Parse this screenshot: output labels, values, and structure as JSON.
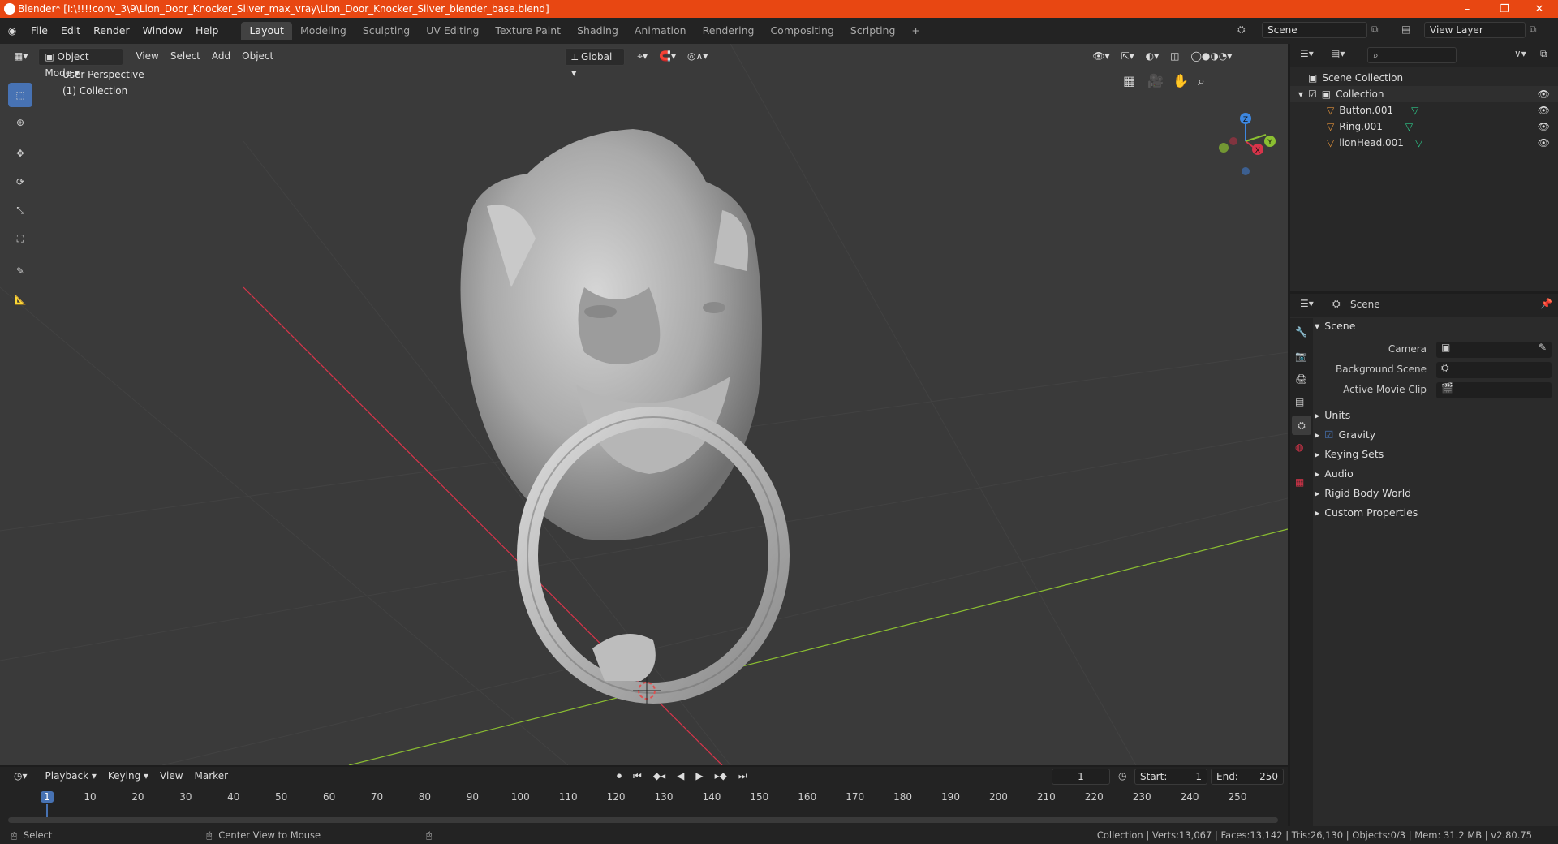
{
  "window": {
    "title": "Blender* [I:\\!!!!conv_3\\9\\Lion_Door_Knocker_Silver_max_vray\\Lion_Door_Knocker_Silver_blender_base.blend]",
    "minimize": "–",
    "maximize": "❐",
    "close": "✕"
  },
  "menu": {
    "items": [
      "File",
      "Edit",
      "Render",
      "Window",
      "Help"
    ],
    "workspaces": [
      "Layout",
      "Modeling",
      "Sculpting",
      "UV Editing",
      "Texture Paint",
      "Shading",
      "Animation",
      "Rendering",
      "Compositing",
      "Scripting"
    ],
    "add_workspace": "+",
    "scene": "Scene",
    "view_layer": "View Layer"
  },
  "viewport": {
    "mode": "Object Mode",
    "menus": [
      "View",
      "Select",
      "Add",
      "Object"
    ],
    "transform": "Global",
    "overlay_line1": "User Perspective",
    "overlay_line2": "(1) Collection",
    "gizmo": {
      "z": "Z",
      "y": "Y",
      "x": "X"
    }
  },
  "outliner": {
    "root": "Scene Collection",
    "collection": "Collection",
    "objects": [
      "Button.001",
      "Ring.001",
      "lionHead.001"
    ]
  },
  "properties": {
    "header": "Scene",
    "panel": "Scene",
    "fields": [
      "Camera",
      "Background Scene",
      "Active Movie Clip"
    ],
    "sections": [
      "Units",
      "Gravity",
      "Keying Sets",
      "Audio",
      "Rigid Body World",
      "Custom Properties"
    ]
  },
  "timeline": {
    "menus": [
      "Playback",
      "Keying",
      "View",
      "Marker"
    ],
    "current_frame": "1",
    "start_label": "Start:",
    "start": "1",
    "end_label": "End:",
    "end": "250",
    "ticks": [
      "1",
      "10",
      "20",
      "30",
      "40",
      "50",
      "60",
      "70",
      "80",
      "90",
      "100",
      "110",
      "120",
      "130",
      "140",
      "150",
      "160",
      "170",
      "180",
      "190",
      "200",
      "210",
      "220",
      "230",
      "240",
      "250"
    ]
  },
  "status": {
    "select": "Select",
    "center": "Center View to Mouse",
    "stats": "Collection | Verts:13,067 | Faces:13,142 | Tris:26,130 | Objects:0/3 | Mem: 31.2 MB | v2.80.75"
  },
  "colors": {
    "titlebar": "#e84712",
    "accent": "#4772b3",
    "x_axis": "#d8344a",
    "y_axis": "#8bbf31",
    "z_axis": "#3d87e0",
    "object_icon": "#e0913a",
    "mesh_icon": "#2ec98a"
  }
}
